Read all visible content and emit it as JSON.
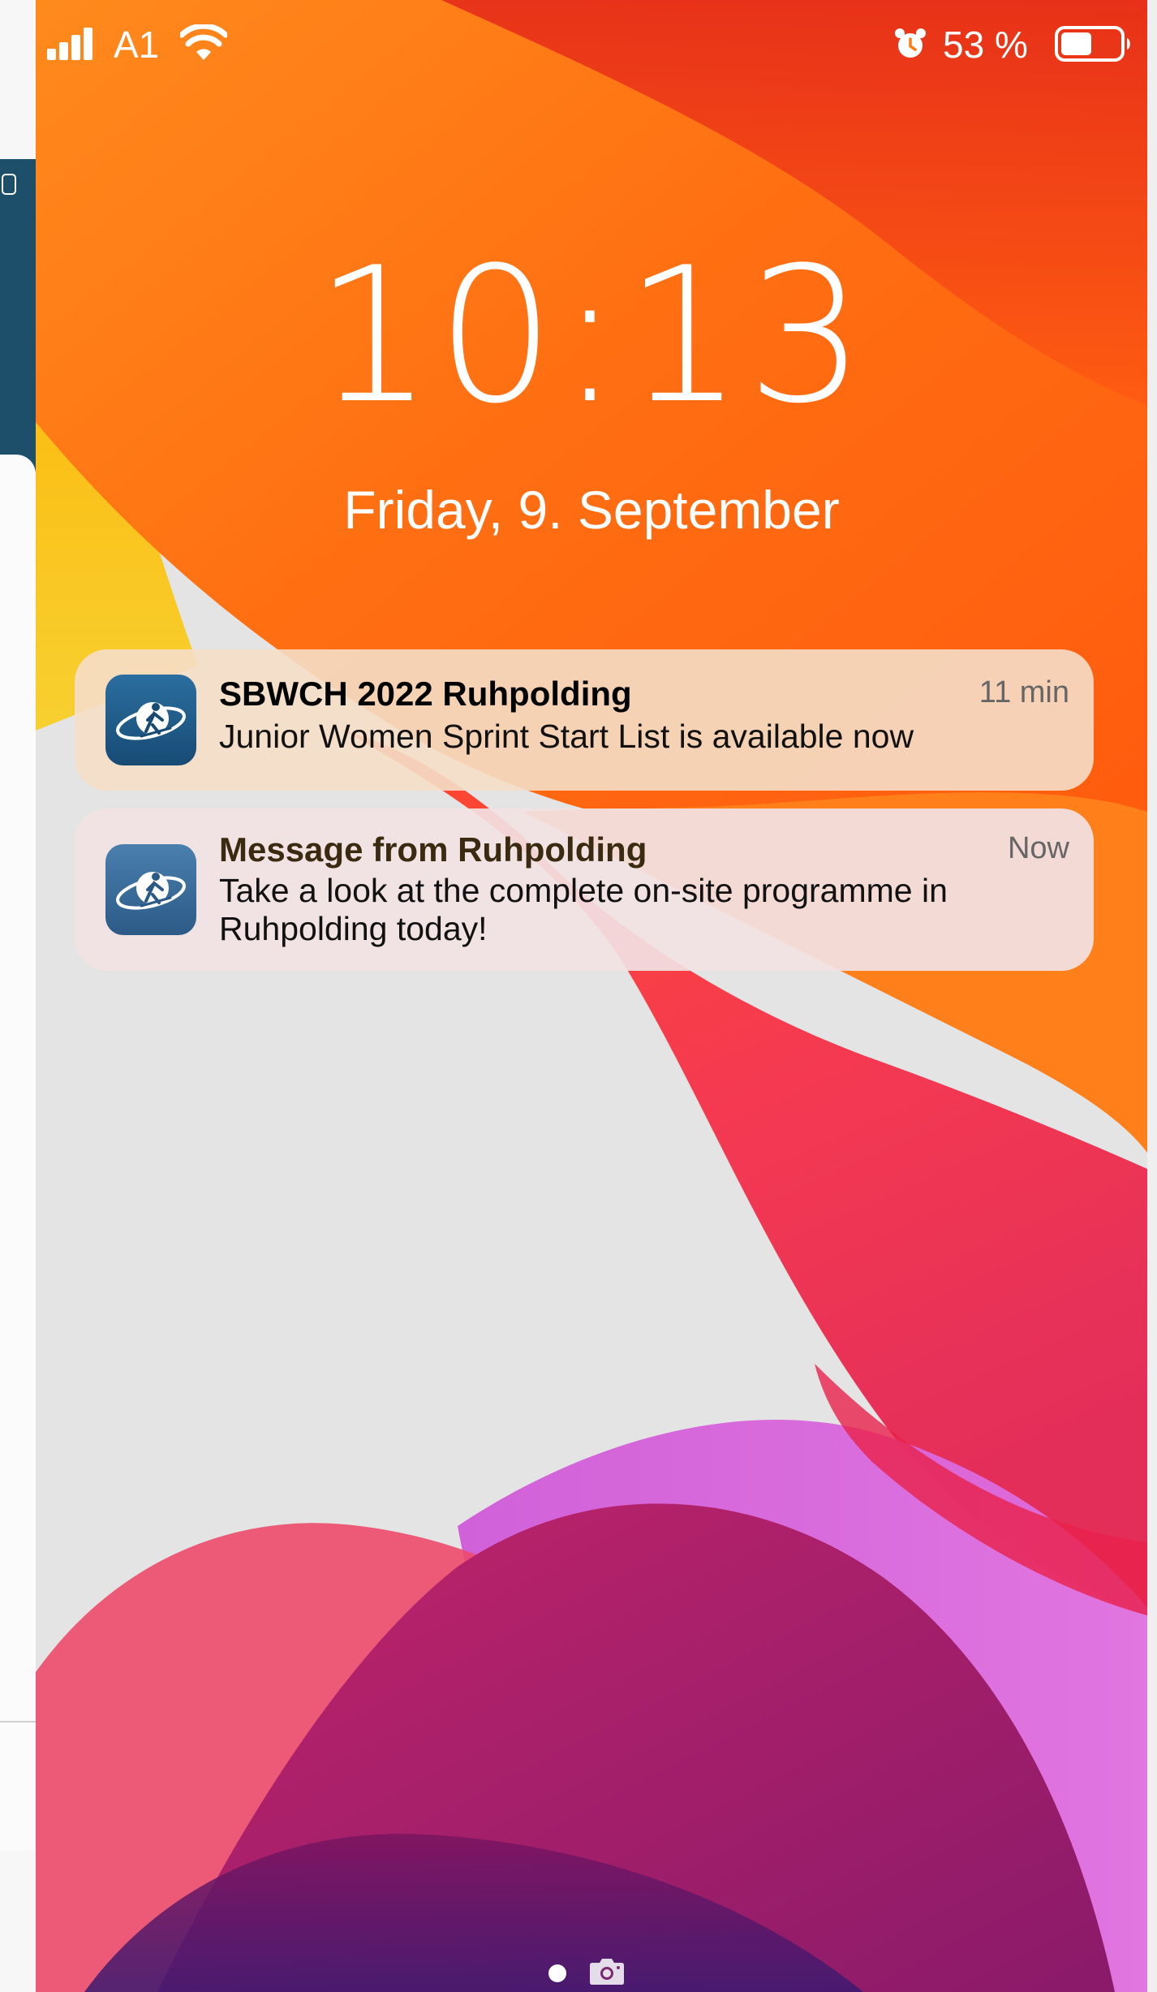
{
  "status_bar": {
    "carrier": "A1",
    "battery_percent": "53 %",
    "battery_level": 0.53,
    "icons": [
      "signal-icon",
      "wifi-icon",
      "alarm-icon",
      "battery-icon"
    ]
  },
  "lock_screen": {
    "time": "10:13",
    "date": "Friday, 9. September"
  },
  "notifications": [
    {
      "title": "SBWCH 2022 Ruhpolding",
      "time": "11 min",
      "body": "Junior Women Sprint Start List is available now",
      "icon": "biathlon-app-icon"
    },
    {
      "title": "Message from Ruhpolding",
      "time": "Now",
      "body": "Take a look at the complete on-site programme in Ruhpolding today!",
      "icon": "biathlon-app-icon"
    }
  ],
  "bottom": {
    "icons": [
      "page-indicator-dot",
      "camera-icon"
    ]
  },
  "colors": {
    "app_icon": "#1f5a86",
    "wallpaper_orange": "#ff7a10",
    "wallpaper_red": "#f0304a",
    "wallpaper_purple": "#a02a8a"
  }
}
